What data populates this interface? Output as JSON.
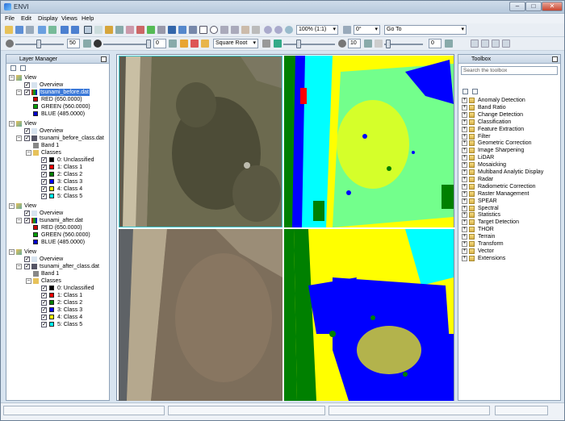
{
  "app": {
    "title": "ENVI"
  },
  "menu": [
    "File",
    "Edit",
    "Display",
    "Views",
    "Help"
  ],
  "toolbar": {
    "zoom": "100% (1:1)",
    "rotation": "0°",
    "goto": "Go To"
  },
  "toolbar2": {
    "brightness": "50",
    "contrast": "0",
    "stretch": "Square Root",
    "sharpen": "10",
    "transparency": "0"
  },
  "layer_manager": {
    "title": "Layer Manager",
    "views": [
      {
        "label": "View",
        "layers": [
          {
            "label": "Overview"
          },
          {
            "label": "tsunami_before.dat",
            "selected": true,
            "bands": [
              {
                "label": "RED (650.0000)",
                "color": "#d00000"
              },
              {
                "label": "GREEN (560.0000)",
                "color": "#00a000"
              },
              {
                "label": "BLUE (485.0000)",
                "color": "#0000d0"
              }
            ]
          }
        ]
      },
      {
        "label": "View",
        "layers": [
          {
            "label": "Overview"
          },
          {
            "label": "tsunami_before_class.dat",
            "band": "Band 1",
            "classes_label": "Classes",
            "classes": [
              {
                "label": "0: Unclassified",
                "color": "#000000"
              },
              {
                "label": "1: Class 1",
                "color": "#ff0000"
              },
              {
                "label": "2: Class 2",
                "color": "#008000"
              },
              {
                "label": "3: Class 3",
                "color": "#0000ff"
              },
              {
                "label": "4: Class 4",
                "color": "#ffff00"
              },
              {
                "label": "5: Class 5",
                "color": "#00ffff"
              }
            ]
          }
        ]
      },
      {
        "label": "View",
        "layers": [
          {
            "label": "Overview"
          },
          {
            "label": "tsunami_after.dat",
            "bands": [
              {
                "label": "RED (650.0000)",
                "color": "#d00000"
              },
              {
                "label": "GREEN (560.0000)",
                "color": "#00a000"
              },
              {
                "label": "BLUE (485.0000)",
                "color": "#0000d0"
              }
            ]
          }
        ]
      },
      {
        "label": "View",
        "layers": [
          {
            "label": "Overview"
          },
          {
            "label": "tsunami_after_class.dat",
            "band": "Band 1",
            "classes_label": "Classes",
            "classes": [
              {
                "label": "0: Unclassified",
                "color": "#000000"
              },
              {
                "label": "1: Class 1",
                "color": "#ff0000"
              },
              {
                "label": "2: Class 2",
                "color": "#008000"
              },
              {
                "label": "3: Class 3",
                "color": "#0000ff"
              },
              {
                "label": "4: Class 4",
                "color": "#ffff00"
              },
              {
                "label": "5: Class 5",
                "color": "#00ffff"
              }
            ]
          }
        ]
      }
    ]
  },
  "toolbox": {
    "title": "Toolbox",
    "search_placeholder": "Search the toolbox",
    "items": [
      "Anomaly Detection",
      "Band Ratio",
      "Change Detection",
      "Classification",
      "Feature Extraction",
      "Filter",
      "Geometric Correction",
      "Image Sharpening",
      "LiDAR",
      "Mosaicking",
      "Multiband Analytic Display",
      "Radar",
      "Radiometric Correction",
      "Raster Management",
      "SPEAR",
      "Spectral",
      "Statistics",
      "Target Detection",
      "THOR",
      "Terrain",
      "Transform",
      "Vector",
      "Extensions"
    ]
  },
  "colors": {
    "selection": "#3a78d8",
    "class_yellow": "#ffff00",
    "class_cyan": "#00ffff",
    "class_blue": "#0000ff",
    "class_green": "#008000",
    "class_red": "#ff0000"
  }
}
